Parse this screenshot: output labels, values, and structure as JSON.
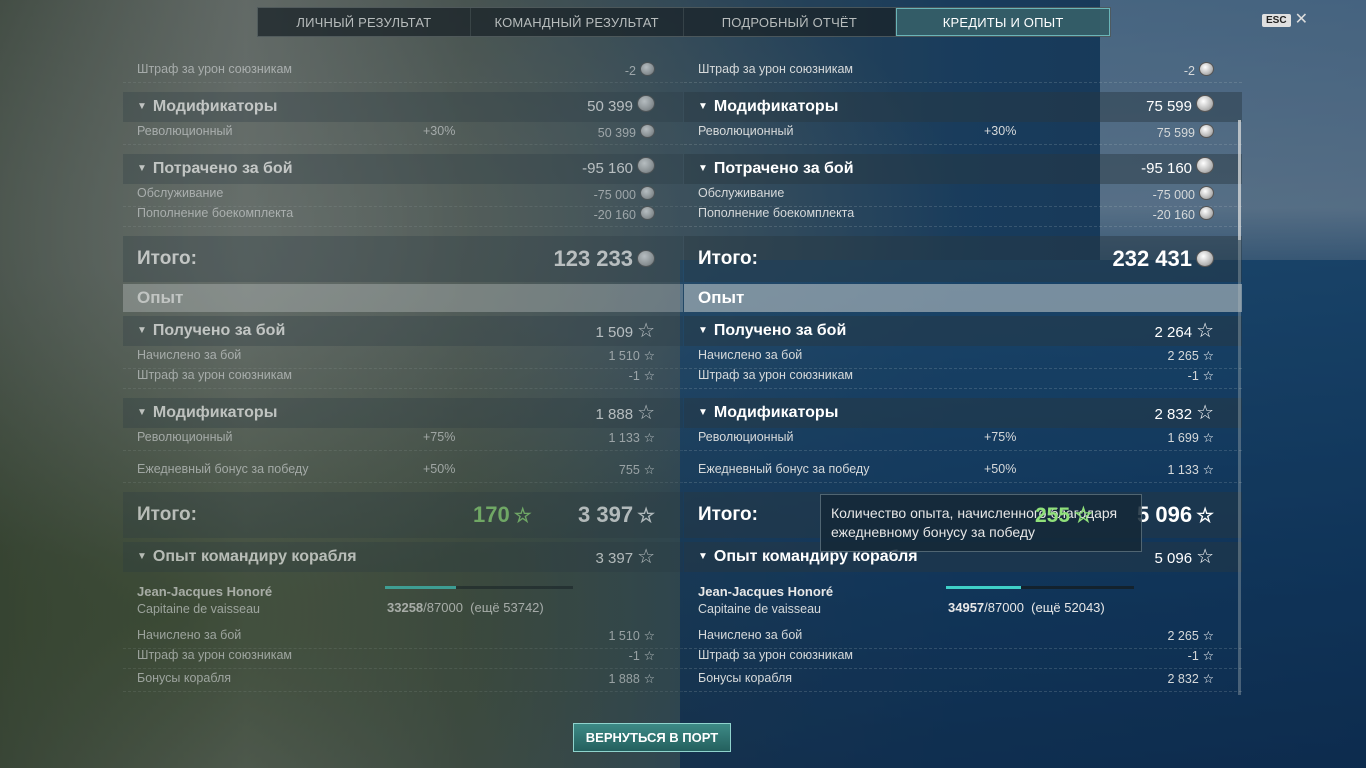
{
  "tabs": [
    "ЛИЧНЫЙ РЕЗУЛЬТАТ",
    "КОМАНДНЫЙ РЕЗУЛЬТАТ",
    "ПОДРОБНЫЙ ОТЧЁТ",
    "КРЕДИТЫ И ОПЫТ"
  ],
  "active_tab": 3,
  "esc_label": "ESC",
  "left": {
    "penalty_label": "Штраф за урон союзникам",
    "penalty_value": "-2",
    "modifiers_label": "Модификаторы",
    "modifiers_value": "50 399",
    "revolutionary_label": "Революционный",
    "revolutionary_pct": "+30%",
    "revolutionary_value": "50 399",
    "spent_label": "Потрачено за бой",
    "spent_value": "-95 160",
    "service_label": "Обслуживание",
    "service_value": "-75 000",
    "ammo_label": "Пополнение боекомплекта",
    "ammo_value": "-20 160",
    "total_label": "Итого:",
    "total_value": "123 233",
    "xp_header": "Опыт",
    "earned_label": "Получено за бой",
    "earned_value": "1 509",
    "accrued_label": "Начислено за бой",
    "accrued_value": "1 510",
    "xp_penalty_label": "Штраф за урон союзникам",
    "xp_penalty_value": "-1",
    "xp_mod_label": "Модификаторы",
    "xp_mod_value": "1 888",
    "xp_rev_label": "Революционный",
    "xp_rev_pct": "+75%",
    "xp_rev_value": "1 133",
    "daily_label": "Ежедневный бонус за победу",
    "daily_pct": "+50%",
    "daily_value": "755",
    "xp_total_label": "Итого:",
    "xp_total_bonus": "170",
    "xp_total_value": "3 397",
    "cmd_label": "Опыт командиру корабля",
    "cmd_value": "3 397",
    "cmd_name": "Jean-Jacques Honoré",
    "cmd_rank": "Capitaine de vaisseau",
    "cmd_xp_current": "33258",
    "cmd_xp_total": "/87000",
    "cmd_xp_left": "(ещё 53742)",
    "cmd_xp_progress": 0.38,
    "cmd_accrued_label": "Начислено за бой",
    "cmd_accrued_value": "1 510",
    "cmd_penalty_label": "Штраф за урон союзникам",
    "cmd_penalty_value": "-1",
    "cmd_bonus_label": "Бонусы корабля",
    "cmd_bonus_value": "1 888"
  },
  "right": {
    "penalty_label": "Штраф за урон союзникам",
    "penalty_value": "-2",
    "modifiers_label": "Модификаторы",
    "modifiers_value": "75 599",
    "revolutionary_label": "Революционный",
    "revolutionary_pct": "+30%",
    "revolutionary_value": "75 599",
    "spent_label": "Потрачено за бой",
    "spent_value": "-95 160",
    "service_label": "Обслуживание",
    "service_value": "-75 000",
    "ammo_label": "Пополнение боекомплекта",
    "ammo_value": "-20 160",
    "total_label": "Итого:",
    "total_value": "232 431",
    "xp_header": "Опыт",
    "earned_label": "Получено за бой",
    "earned_value": "2 264",
    "accrued_label": "Начислено за бой",
    "accrued_value": "2 265",
    "xp_penalty_label": "Штраф за урон союзникам",
    "xp_penalty_value": "-1",
    "xp_mod_label": "Модификаторы",
    "xp_mod_value": "2 832",
    "xp_rev_label": "Революционный",
    "xp_rev_pct": "+75%",
    "xp_rev_value": "1 699",
    "daily_label": "Ежедневный бонус за победу",
    "daily_pct": "+50%",
    "daily_value": "1 133",
    "xp_total_label": "Итого:",
    "xp_total_bonus": "255",
    "xp_total_value": "5 096",
    "cmd_label": "Опыт командиру корабля",
    "cmd_value": "5 096",
    "cmd_name": "Jean-Jacques Honoré",
    "cmd_rank": "Capitaine de vaisseau",
    "cmd_xp_current": "34957",
    "cmd_xp_total": "/87000",
    "cmd_xp_left": "(ещё 52043)",
    "cmd_xp_progress": 0.4,
    "cmd_accrued_label": "Начислено за бой",
    "cmd_accrued_value": "2 265",
    "cmd_penalty_label": "Штраф за урон союзникам",
    "cmd_penalty_value": "-1",
    "cmd_bonus_label": "Бонусы корабля",
    "cmd_bonus_value": "2 832"
  },
  "tooltip": "Количество опыта, начисленного благодаря ежедневному бонусу за победу",
  "return_button": "ВЕРНУТЬСЯ В ПОРТ",
  "colors": {
    "accent": "#3fd0c8",
    "bonus_green": "#8fe07a",
    "active_tab": "#3c6e78"
  }
}
